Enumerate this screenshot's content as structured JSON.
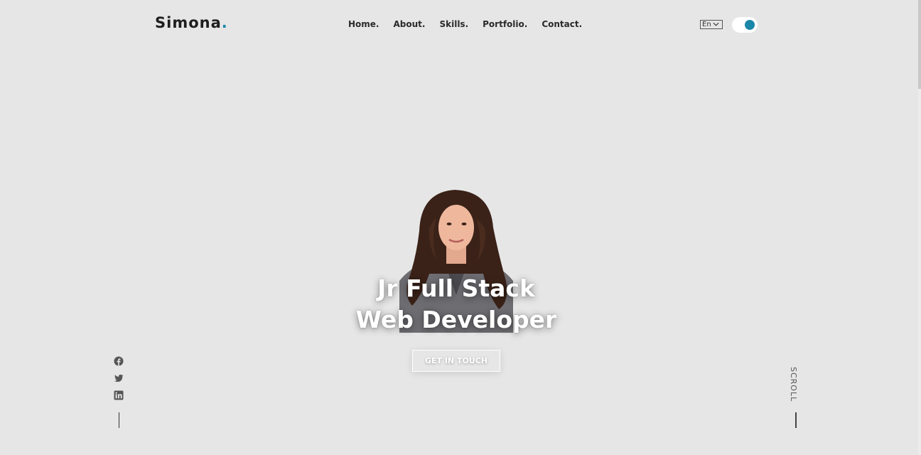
{
  "header": {
    "logo_text": "Simona",
    "logo_dot": ".",
    "nav": [
      "Home.",
      "About.",
      "Skills.",
      "Portfolio.",
      "Contact."
    ],
    "language": "En",
    "theme_toggle": "on"
  },
  "hero": {
    "title_line1": "Jr Full Stack",
    "title_line2": "Web Developer",
    "cta_label": "GET IN TOUCH"
  },
  "social": {
    "icons": [
      "facebook-icon",
      "twitter-icon",
      "linkedin-icon"
    ]
  },
  "scroll": {
    "label": "SCROLL"
  },
  "colors": {
    "background": "#e6e6e6",
    "accent": "#1a87a8",
    "text": "#1e1e1e"
  }
}
